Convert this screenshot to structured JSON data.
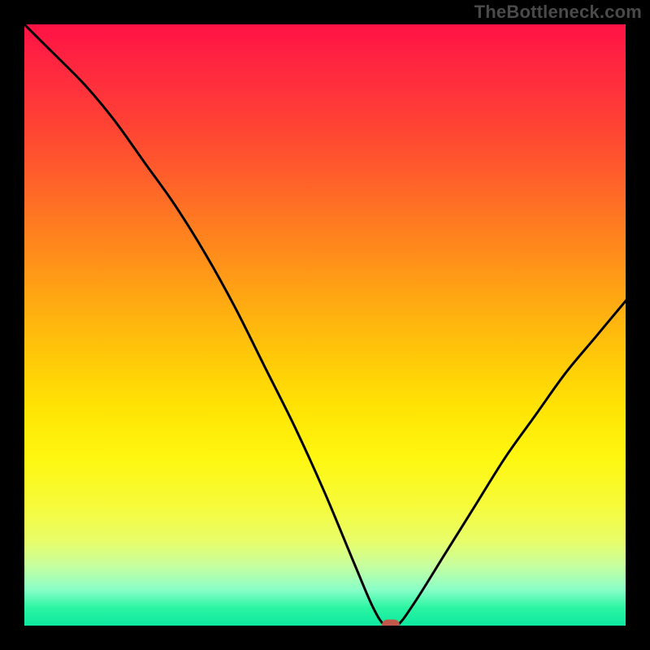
{
  "watermark": {
    "text": "TheBottleneck.com"
  },
  "chart_data": {
    "type": "line",
    "title": "",
    "xlabel": "",
    "ylabel": "",
    "xlim": [
      0,
      100
    ],
    "ylim": [
      0,
      100
    ],
    "grid": false,
    "legend": false,
    "gradient_stops": [
      {
        "pct": 0,
        "color": "#ff1245"
      },
      {
        "pct": 50,
        "color": "#ffcb08"
      },
      {
        "pct": 85,
        "color": "#f6fb3a"
      },
      {
        "pct": 100,
        "color": "#0ee89e"
      }
    ],
    "series": [
      {
        "name": "bottleneck-curve",
        "x": [
          0,
          5,
          10,
          15,
          20,
          25,
          30,
          35,
          40,
          45,
          50,
          55,
          58,
          60,
          62,
          65,
          70,
          75,
          80,
          85,
          90,
          95,
          100
        ],
        "values": [
          100,
          95,
          90,
          84,
          77,
          70,
          62,
          53,
          43,
          33,
          22,
          10,
          3,
          0,
          0,
          4,
          12,
          20,
          28,
          35,
          42,
          48,
          54
        ]
      }
    ],
    "marker": {
      "x": 61,
      "y": 0,
      "color": "#c15a4b"
    }
  }
}
